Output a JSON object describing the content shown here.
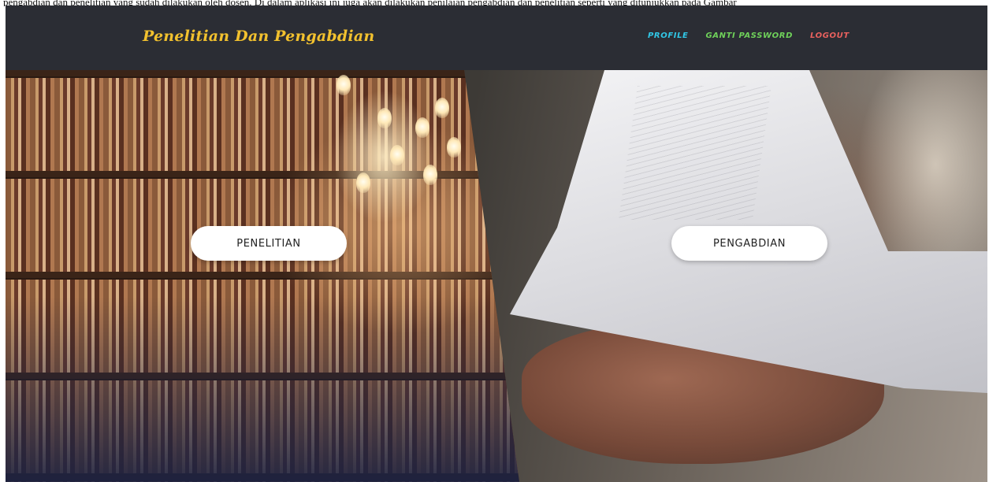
{
  "caption": {
    "text": "pengabdian dan penelitian yang sudah dilakukan oleh dosen. Di dalam aplikasi ini juga akan dilakukan penilaian pengabdian dan penelitian seperti yang ditunjukkan pada Gambar"
  },
  "navbar": {
    "brand": "Penelitian Dan Pengabdian",
    "brand_color": "#f2c12e",
    "links": [
      {
        "label": "PROFILE",
        "color": "#31c7e6"
      },
      {
        "label": "GANTI PASSWORD",
        "color": "#6fd15a"
      },
      {
        "label": "LOGOUT",
        "color": "#e8615e"
      }
    ],
    "background": "#2b2d34"
  },
  "hero": {
    "left_button": "PENELITIAN",
    "right_button": "PENGABDIAN"
  }
}
